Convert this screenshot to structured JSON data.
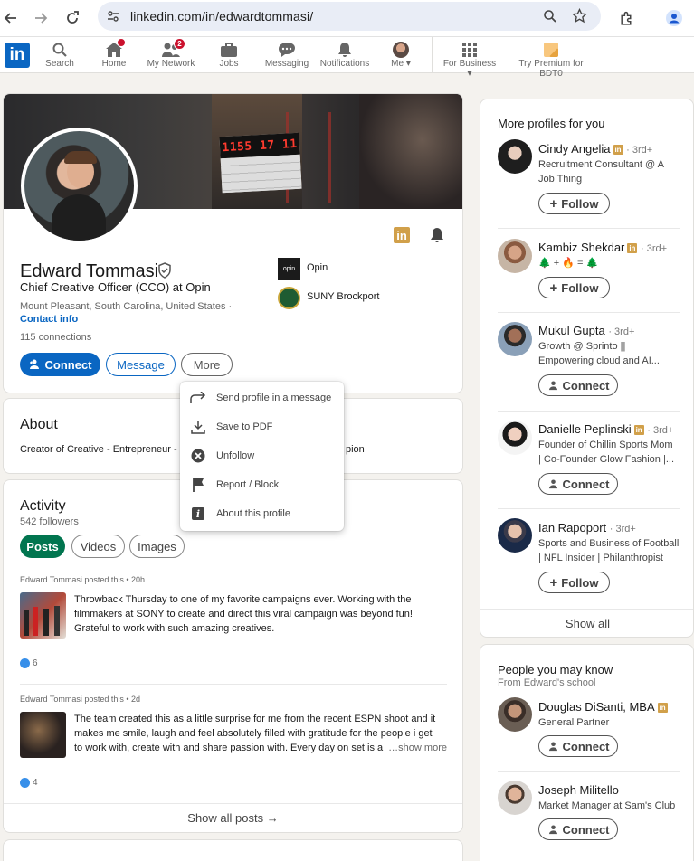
{
  "browser": {
    "url": "linkedin.com/in/edwardtommasi/"
  },
  "nav": {
    "search": "Search",
    "home": "Home",
    "network": "My Network",
    "network_badge": "2",
    "jobs": "Jobs",
    "messaging": "Messaging",
    "notifications": "Notifications",
    "me": "Me",
    "business": "For Business",
    "premium": "Try Premium for BDT0"
  },
  "profile": {
    "name": "Edward Tommasi",
    "headline": "Chief Creative Officer (CCO) at Opin",
    "location": "Mount Pleasant, South Carolina, United States ·",
    "contact": "Contact info",
    "connections": "115 connections",
    "company": "Opin",
    "school": "SUNY Brockport",
    "btn_connect": "Connect",
    "btn_message": "Message",
    "btn_more": "More",
    "clapper": "1155 17 11"
  },
  "more_menu": [
    {
      "label": "Send profile in a message",
      "icon": "share-arrow-icon"
    },
    {
      "label": "Save to PDF",
      "icon": "download-icon"
    },
    {
      "label": "Unfollow",
      "icon": "close-circle-icon"
    },
    {
      "label": "Report / Block",
      "icon": "flag-icon"
    },
    {
      "label": "About this profile",
      "icon": "info-icon"
    }
  ],
  "about": {
    "title": "About",
    "text_left": "Creator of Creative - Entrepreneur -",
    "text_right": "pion"
  },
  "activity": {
    "title": "Activity",
    "followers": "542 followers",
    "tabs": [
      "Posts",
      "Videos",
      "Images"
    ],
    "posts": [
      {
        "meta": "Edward Tommasi posted this • 20h",
        "lines": [
          "Throwback Thursday to one of my favorite campaigns ever. Working with the",
          "filmmakers at SONY to create and direct this viral campaign was beyond fun!",
          "Grateful to work with such amazing creatives."
        ],
        "reactions": "6"
      },
      {
        "meta": "Edward Tommasi posted this • 2d",
        "lines": [
          "The team created this as a little surprise for me from the recent ESPN shoot and it",
          "makes me smile, laugh and feel absolutely filled with gratitude for the people i get",
          "to work with, create with and share passion with. Every day on set is a"
        ],
        "show_more": "…show more",
        "reactions": "4"
      }
    ],
    "show_all": "Show all posts →"
  },
  "more_profiles": {
    "title": "More profiles for you",
    "items": [
      {
        "name": "Cindy Angelia",
        "degree": "· 3rd+",
        "sub": [
          "Recruitment Consultant @ A",
          "Job Thing"
        ],
        "button": "Follow"
      },
      {
        "name": "Kambiz Shekdar",
        "degree": "· 3rd+",
        "sub": [
          "🌲 + 🔥 = 🌲"
        ],
        "button": "Follow"
      },
      {
        "name": "Mukul Gupta",
        "degree": "· 3rd+",
        "sub": [
          "Growth @ Sprinto ||",
          "Empowering cloud and AI..."
        ],
        "button": "Connect"
      },
      {
        "name": "Danielle Peplinski",
        "degree": "· 3rd+",
        "sub": [
          "Founder of Chillin Sports Mom",
          "| Co-Founder Glow Fashion |..."
        ],
        "button": "Connect"
      },
      {
        "name": "Ian Rapoport",
        "degree": "· 3rd+",
        "sub": [
          "Sports and Business of Football",
          "| NFL Insider | Philanthropist"
        ],
        "button": "Follow"
      }
    ],
    "show_all": "Show all"
  },
  "people_know": {
    "title": "People you may know",
    "subtitle": "From Edward's school",
    "items": [
      {
        "name": "Douglas DiSanti, MBA",
        "sub": "General Partner",
        "button": "Connect"
      },
      {
        "name": "Joseph Militello",
        "sub": "Market Manager at Sam's Club",
        "button": "Connect"
      }
    ]
  },
  "colors": {
    "brand": "#0a66c2",
    "green": "#01754f",
    "premium": "#f8c77e"
  }
}
